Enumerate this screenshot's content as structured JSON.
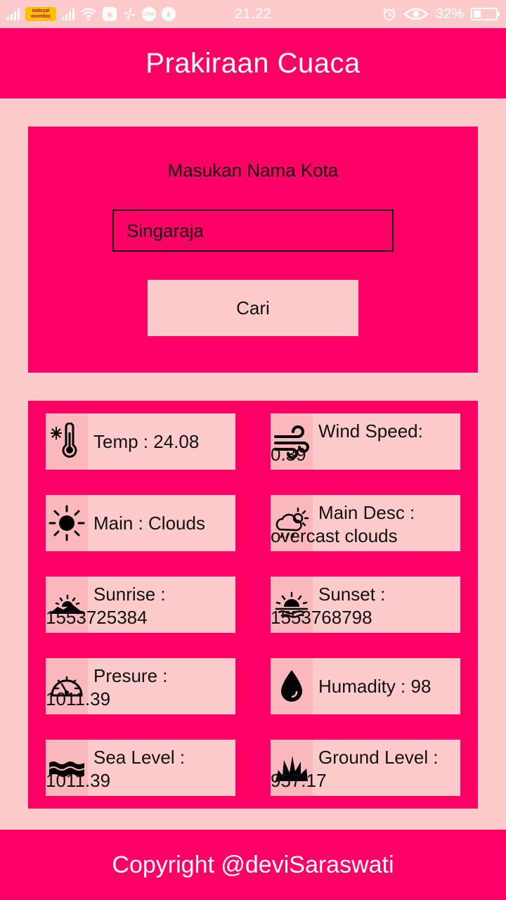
{
  "status_bar": {
    "carrier": "indosat ooredoo",
    "time": "21.22",
    "battery": "32%",
    "battery_level": 0.32,
    "icons": [
      "signal-icon",
      "carrier-logo",
      "signal-icon",
      "wifi-icon",
      "app-icon",
      "pinwheel-icon",
      "line-icon",
      "arrow-app-icon",
      "alarm-icon",
      "eye-icon",
      "battery-icon"
    ]
  },
  "header": {
    "title": "Prakiraan Cuaca"
  },
  "search": {
    "label": "Masukan Nama Kota",
    "input_value": "Singaraja",
    "button_label": "Cari"
  },
  "weather": {
    "temp": "Temp : 24.08",
    "wind_label": "Wind Speed:",
    "wind_value": "0.39",
    "main": "Main : Clouds",
    "desc_label": "Main Desc :",
    "desc_value": "overcast clouds",
    "sunrise_label": "Sunrise :",
    "sunrise_value": "1553725384",
    "sunset_label": "Sunset :",
    "sunset_value": "1553768798",
    "pressure_label": "Presure :",
    "pressure_value": "1011.39",
    "humidity": "Humadity : 98",
    "sea_label": "Sea Level :",
    "sea_value": "1011.39",
    "ground_label": "Ground Level :",
    "ground_value": "957.17"
  },
  "footer": {
    "text": "Copyright @deviSaraswati"
  },
  "colors": {
    "primary": "#ff0066",
    "background": "#fdcbcb",
    "icon_bg": "#fbb8bd"
  }
}
